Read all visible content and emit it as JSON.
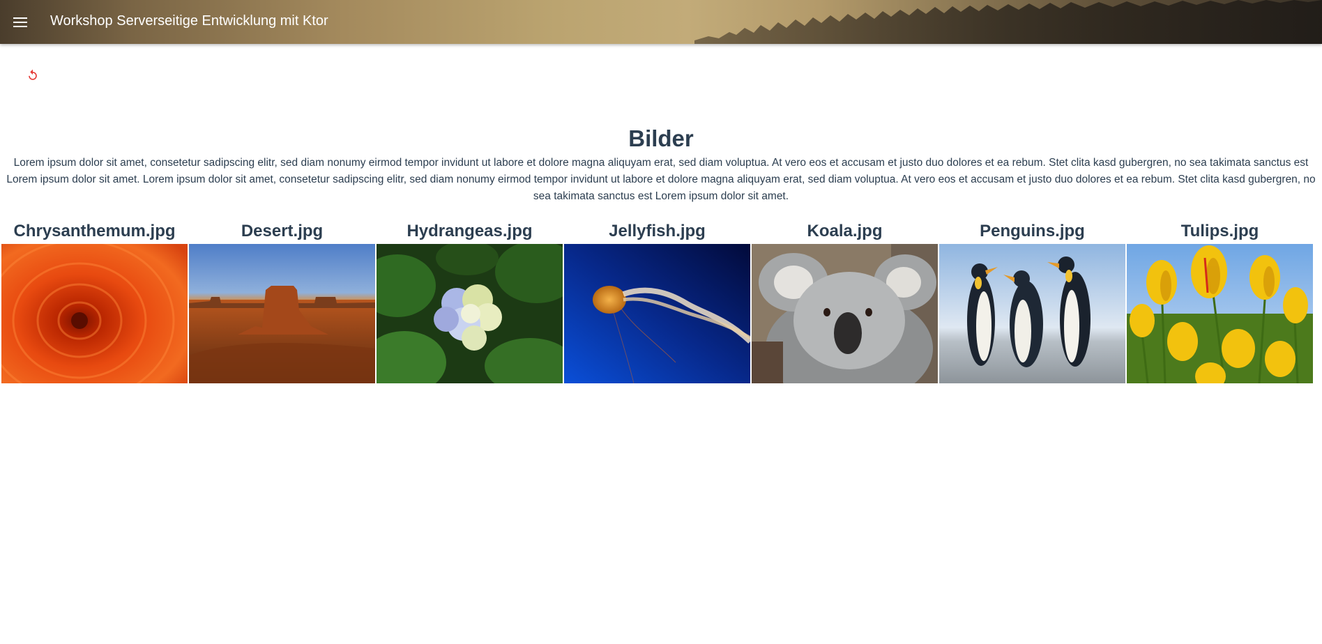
{
  "header": {
    "title": "Workshop Serverseitige Entwicklung mit Ktor",
    "menu_icon": "menu-icon"
  },
  "toolbar": {
    "reload_icon": "reload-icon",
    "accent": "#e53935"
  },
  "main": {
    "title": "Bilder",
    "text": "Lorem ipsum dolor sit amet, consetetur sadipscing elitr, sed diam nonumy eirmod tempor invidunt ut labore et dolore magna aliquyam erat, sed diam voluptua. At vero eos et accusam et justo duo dolores et ea rebum. Stet clita kasd gubergren, no sea takimata sanctus est Lorem ipsum dolor sit amet. Lorem ipsum dolor sit amet, consetetur sadipscing elitr, sed diam nonumy eirmod tempor invidunt ut labore et dolore magna aliquyam erat, sed diam voluptua. At vero eos et accusam et justo duo dolores et ea rebum. Stet clita kasd gubergren, no sea takimata sanctus est Lorem ipsum dolor sit amet."
  },
  "images": [
    {
      "name": "Chrysanthemum.jpg"
    },
    {
      "name": "Desert.jpg"
    },
    {
      "name": "Hydrangeas.jpg"
    },
    {
      "name": "Jellyfish.jpg"
    },
    {
      "name": "Koala.jpg"
    },
    {
      "name": "Penguins.jpg"
    },
    {
      "name": "Tulips.jpg"
    }
  ],
  "colors": {
    "text": "#2c3e50",
    "header_text": "#ffffff"
  }
}
